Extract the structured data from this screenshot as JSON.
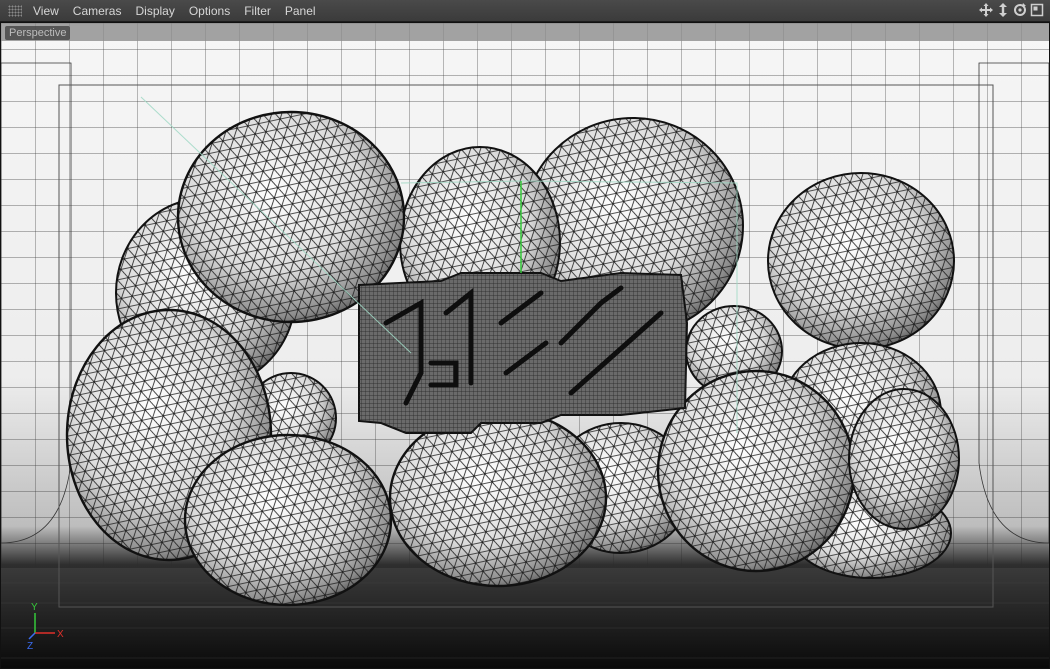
{
  "menu": {
    "items": [
      "View",
      "Cameras",
      "Display",
      "Options",
      "Filter",
      "Panel"
    ]
  },
  "viewport": {
    "camera_label": "Perspective",
    "axis_labels": {
      "x": "X",
      "y": "Y",
      "z": "Z"
    },
    "colors": {
      "axis_x": "#e0302a",
      "axis_y": "#35c93a",
      "axis_z": "#3a6cf0",
      "backdrop_top": "#f4f4f4",
      "floor_dark": "#121212",
      "wire": "#1a1a1a",
      "selection_line": "#9fd8c4"
    }
  },
  "nav_icons": [
    "move-view-icon",
    "dolly-view-icon",
    "rotate-view-icon",
    "maximize-view-icon"
  ]
}
